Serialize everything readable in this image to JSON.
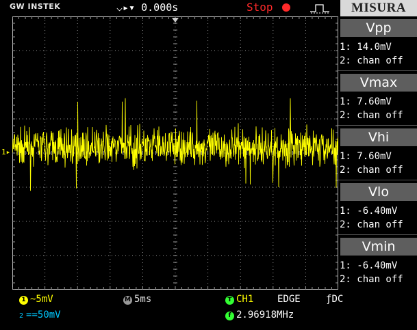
{
  "brand": "GW INSTEK",
  "header": {
    "trigger_position": "0.000s",
    "run_state": "Stop"
  },
  "menu": {
    "title": "MISURA",
    "measurements": [
      {
        "name": "Vpp",
        "ch1": "1: 14.0mV",
        "ch2": "2: chan off"
      },
      {
        "name": "Vmax",
        "ch1": "1: 7.60mV",
        "ch2": "2: chan off"
      },
      {
        "name": "Vhi",
        "ch1": "1: 7.60mV",
        "ch2": "2: chan off"
      },
      {
        "name": "Vlo",
        "ch1": "1: -6.40mV",
        "ch2": "2: chan off"
      },
      {
        "name": "Vmin",
        "ch1": "1: -6.40mV",
        "ch2": "2: chan off"
      }
    ]
  },
  "status": {
    "ch1_badge": "1",
    "ch1_scale": "~5mV",
    "ch2_badge": "2",
    "ch2_scale": "==50mV",
    "timebase_badge": "M",
    "timebase": "5ms",
    "trigger_badge": "T",
    "trigger_source": "CH1",
    "trigger_type": "EDGE",
    "trigger_coupling": "DC",
    "freq_badge": "f",
    "frequency": "2.96918MHz"
  },
  "colors": {
    "ch1": "#ffff00",
    "ch2": "#00c8ff",
    "trigger": "#33ff33",
    "stop": "#ff2a2a",
    "grid": "#9a9a9a"
  },
  "waveform": {
    "channel": "CH1",
    "volts_per_div": 5,
    "unit": "mV",
    "vmax_mV": 7.6,
    "vmin_mV": -6.4,
    "vpp_mV": 14.0
  }
}
